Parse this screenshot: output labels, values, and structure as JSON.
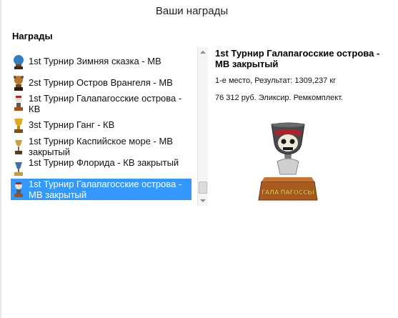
{
  "window": {
    "title": "Ваши награды"
  },
  "awards_section": {
    "title": "Награды"
  },
  "awards": [
    {
      "label": "1st Турнир Зимняя сказка - МВ",
      "icon": "trophy-blue-icon",
      "color": "#2f7fc0"
    },
    {
      "label": "2st Турнир Остров Врангеля - МВ",
      "icon": "trophy-bear-icon",
      "color": "#a0602a"
    },
    {
      "label": "1st Турнир Галапагосские острова - КВ",
      "icon": "trophy-pirate-icon",
      "color": "#8a5a2a"
    },
    {
      "label": "3st Турнир Ганг - КВ",
      "icon": "trophy-gold-icon",
      "color": "#d49a1c"
    },
    {
      "label": "1st Турнир Каспийское море - МВ закрытый",
      "icon": "trophy-cup-icon",
      "color": "#b58a3a"
    },
    {
      "label": "1st Турнир Флорида - КВ закрытый",
      "icon": "trophy-florida-icon",
      "color": "#3d6fb0"
    },
    {
      "label": "1st Турнир Галапагосские острова - МВ закрытый",
      "icon": "trophy-pirate-icon",
      "color": "#8a5a2a"
    }
  ],
  "selected": {
    "title": "1st Турнир Галапагосские острова - МВ закрытый",
    "result": "1-е место, Результат: 1309,237 кг",
    "prize": "76 312 руб. Эликсир. Ремкомплект.",
    "trophy_caption": "ГАЛА ПАГОССЫ"
  }
}
